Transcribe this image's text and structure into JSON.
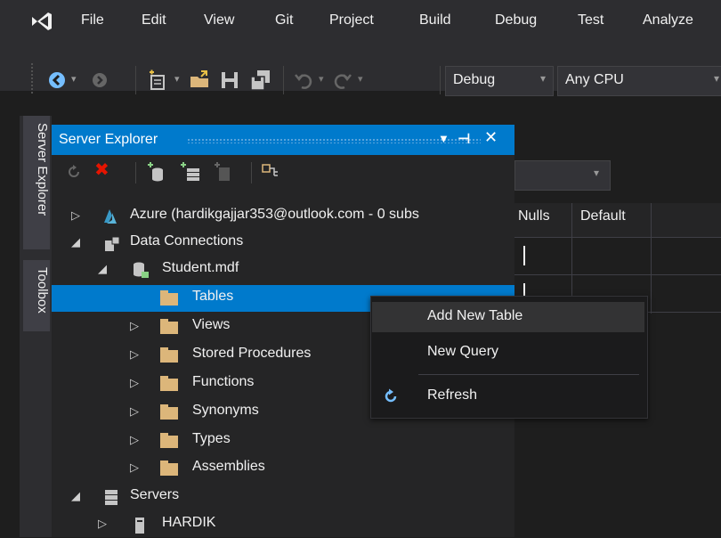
{
  "menu": [
    "File",
    "Edit",
    "View",
    "Git",
    "Project",
    "Build",
    "Debug",
    "Test",
    "Analyze"
  ],
  "toolbar": {
    "config": "Debug",
    "platform": "Any CPU"
  },
  "side_tabs": {
    "server_explorer": "Server Explorer",
    "toolbox": "Toolbox"
  },
  "server_explorer": {
    "title": "Server Explorer",
    "tree": {
      "azure": "Azure (hardikgajjar353@outlook.com - 0 subs",
      "data_connections": "Data Connections",
      "student": "Student.mdf",
      "tables": "Tables",
      "views": "Views",
      "stored_procedures": "Stored Procedures",
      "functions": "Functions",
      "synonyms": "Synonyms",
      "types": "Types",
      "assemblies": "Assemblies",
      "servers": "Servers",
      "hardik": "HARDIK"
    }
  },
  "designer": {
    "columns": [
      "Nulls",
      "Default"
    ]
  },
  "context_menu": {
    "add_new_table": "Add New Table",
    "new_query": "New Query",
    "refresh": "Refresh"
  },
  "colors": {
    "accent": "#007acc",
    "selection": "#007acc",
    "folder": "#dcb67a",
    "error": "#e51400"
  }
}
